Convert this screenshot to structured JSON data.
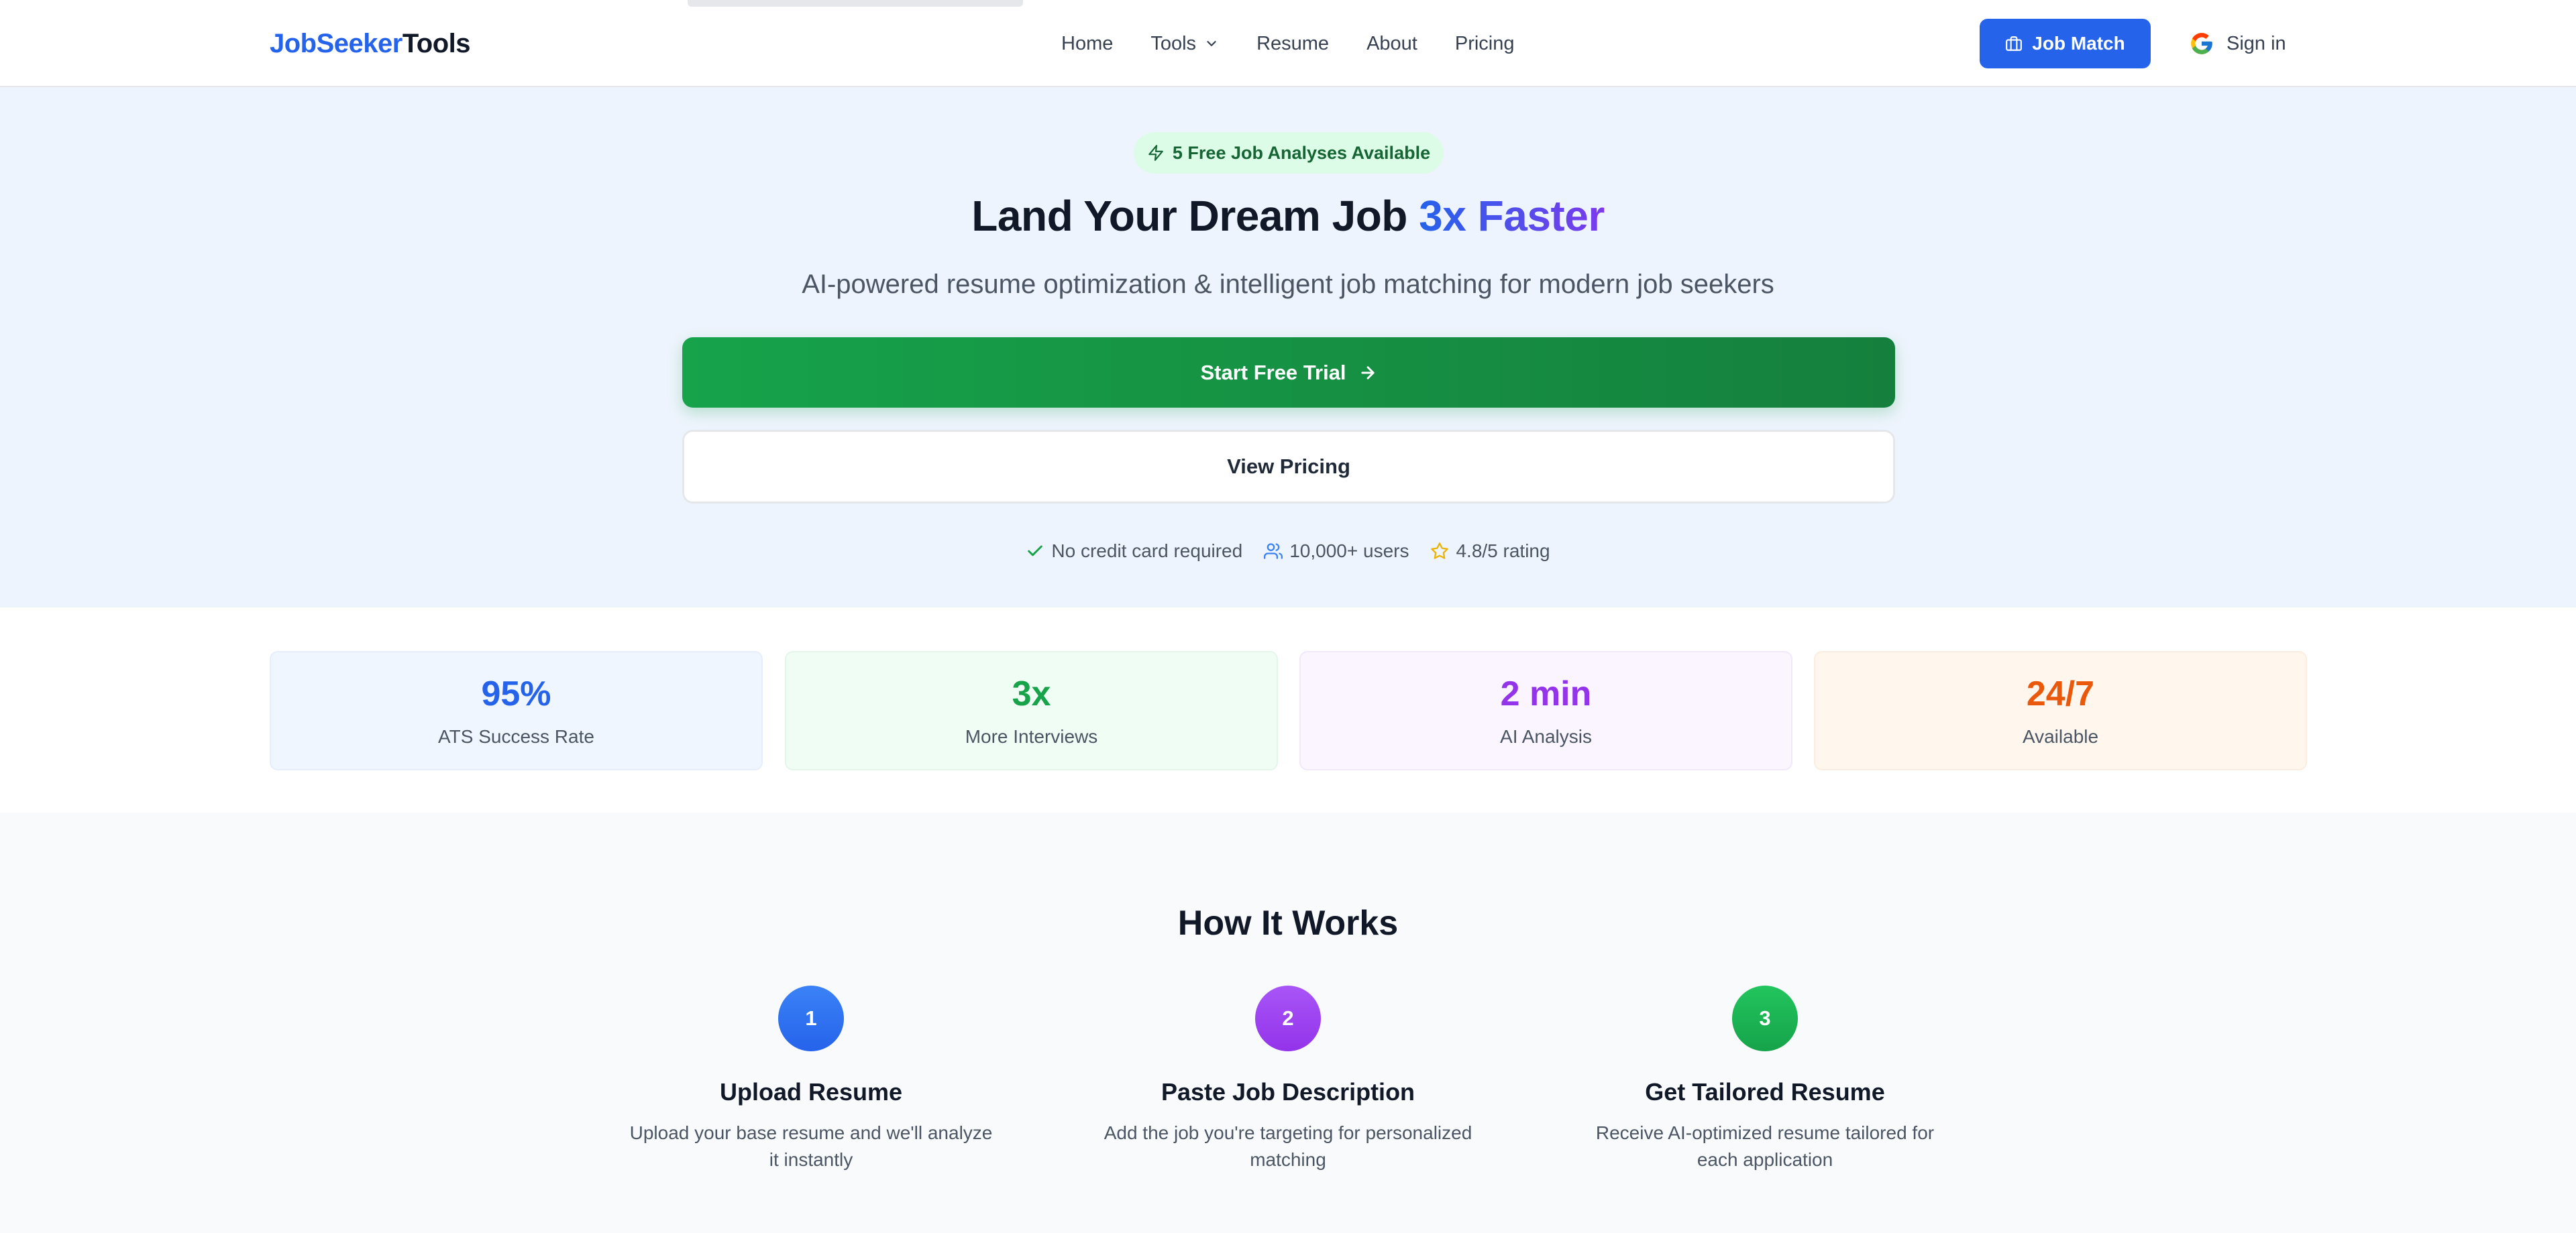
{
  "brand": {
    "part1": "JobSeeker",
    "part2": "Tools"
  },
  "nav": {
    "home": "Home",
    "tools": "Tools",
    "resume": "Resume",
    "about": "About",
    "pricing": "Pricing"
  },
  "header": {
    "job_match": "Job Match",
    "sign_in": "Sign in"
  },
  "hero": {
    "badge": "5 Free Job Analyses Available",
    "title_main": "Land Your Dream Job ",
    "title_accent": "3x Faster",
    "subtitle": "AI-powered resume optimization & intelligent job matching for modern job seekers",
    "cta_primary": "Start Free Trial",
    "cta_secondary": "View Pricing",
    "trust": {
      "no_card": "No credit card required",
      "users": "10,000+ users",
      "rating": "4.8/5 rating"
    }
  },
  "stats": [
    {
      "value": "95%",
      "label": "ATS Success Rate"
    },
    {
      "value": "3x",
      "label": "More Interviews"
    },
    {
      "value": "2 min",
      "label": "AI Analysis"
    },
    {
      "value": "24/7",
      "label": "Available"
    }
  ],
  "how": {
    "title": "How It Works",
    "steps": [
      {
        "number": "1",
        "title": "Upload Resume",
        "desc": "Upload your base resume and we'll analyze it instantly"
      },
      {
        "number": "2",
        "title": "Paste Job Description",
        "desc": "Add the job you're targeting for personalized matching"
      },
      {
        "number": "3",
        "title": "Get Tailored Resume",
        "desc": "Receive AI-optimized resume tailored for each application"
      }
    ]
  },
  "colors": {
    "brand_blue": "#2563eb",
    "cta_green": "#16a34a",
    "purple": "#9333ea",
    "orange": "#ea580c",
    "hero_bg": "#eef4fd"
  },
  "icons": {
    "tools_dropdown": "chevron-down-icon",
    "job_match": "briefcase-icon",
    "sign_in": "google-icon",
    "badge": "lightning-icon",
    "cta": "arrow-right-icon",
    "no_card": "check-icon",
    "users": "users-icon",
    "rating": "star-icon"
  }
}
